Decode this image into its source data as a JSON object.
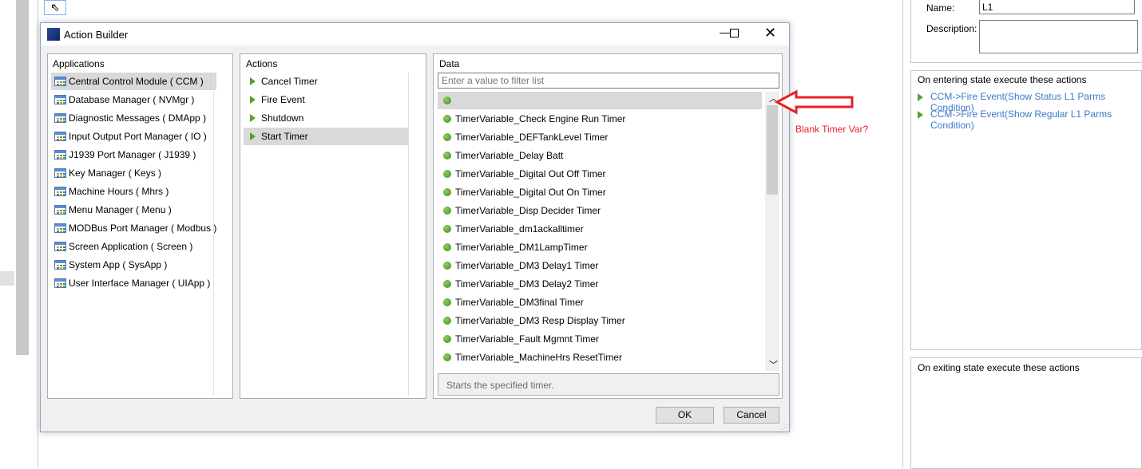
{
  "dialog": {
    "title": "Action Builder",
    "applications_header": "Applications",
    "applications": [
      "Central Control Module  ( CCM )",
      "Database Manager  ( NVMgr )",
      "Diagnostic Messages  ( DMApp )",
      "Input Output Port Manager  ( IO )",
      "J1939 Port Manager  ( J1939 )",
      "Key Manager  ( Keys )",
      "Machine Hours  ( Mhrs )",
      "Menu Manager  ( Menu )",
      "MODBus Port Manager  ( Modbus )",
      "Screen Application  ( Screen )",
      "System App  ( SysApp )",
      "User Interface Manager  ( UIApp )"
    ],
    "selected_application": 0,
    "actions_header": "Actions",
    "actions": [
      "Cancel Timer",
      "Fire Event",
      "Shutdown",
      "Start Timer"
    ],
    "selected_action": 3,
    "data_header": "Data",
    "filter_placeholder": "Enter a value to filter list",
    "data_items": [
      "",
      "TimerVariable_Check Engine Run Timer",
      "TimerVariable_DEFTankLevel Timer",
      "TimerVariable_Delay Batt",
      "TimerVariable_Digital Out Off Timer",
      "TimerVariable_Digital Out On Timer",
      "TimerVariable_Disp Decider Timer",
      "TimerVariable_dm1ackalltimer",
      "TimerVariable_DM1LampTimer",
      "TimerVariable_DM3 Delay1 Timer",
      "TimerVariable_DM3 Delay2 Timer",
      "TimerVariable_DM3final Timer",
      "TimerVariable_DM3 Resp Display Timer",
      "TimerVariable_Fault Mgmnt Timer",
      "TimerVariable_MachineHrs ResetTimer"
    ],
    "selected_data": 0,
    "description": "Starts the specified timer.",
    "ok_label": "OK",
    "cancel_label": "Cancel"
  },
  "annotation": {
    "text": "Blank Timer Var?",
    "color": "#e8202a"
  },
  "right_panel": {
    "name_label": "Name:",
    "name_value": "L1",
    "description_label": "Description:",
    "description_value": "",
    "entering_header": "On entering state execute these actions",
    "entering_actions": [
      "CCM->Fire Event(Show Status L1 Parms Condition)",
      "CCM->Fire Event(Show Regular L1 Parms Condition)"
    ],
    "exiting_header": "On exiting state execute these actions"
  }
}
